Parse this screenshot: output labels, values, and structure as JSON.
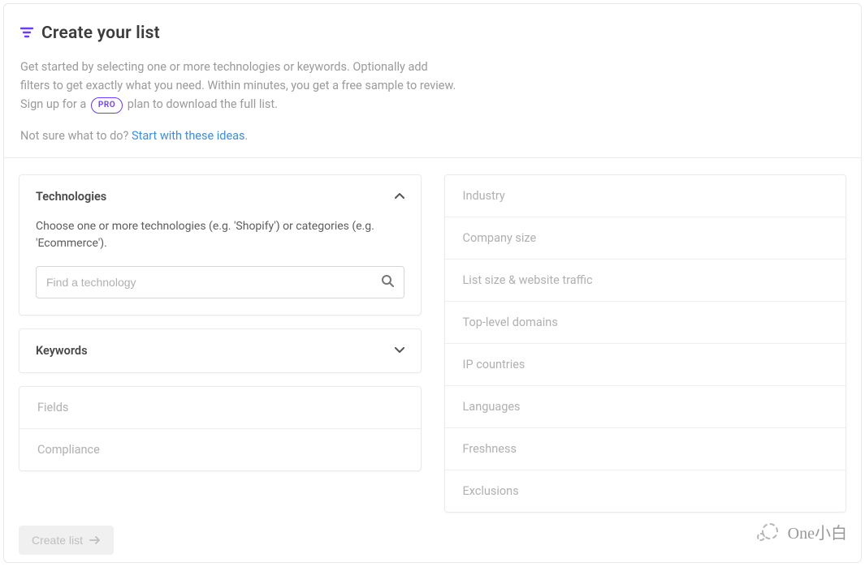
{
  "header": {
    "title": "Create your list",
    "subtitle_before_pro": "Get started by selecting one or more technologies or keywords. Optionally add filters to get exactly what you need. Within minutes, you get a free sample to review. Sign up for a ",
    "pro_label": "PRO",
    "subtitle_after_pro": " plan to download the full list.",
    "hint_prefix": "Not sure what to do? ",
    "hint_link": "Start with these ideas",
    "hint_suffix": "."
  },
  "left": {
    "technologies": {
      "title": "Technologies",
      "desc": "Choose one or more technologies (e.g. 'Shopify') or categories (e.g. 'Ecommerce').",
      "placeholder": "Find a technology"
    },
    "keywords": {
      "title": "Keywords"
    },
    "fields": {
      "title": "Fields"
    },
    "compliance": {
      "title": "Compliance"
    }
  },
  "right": {
    "items": [
      "Industry",
      "Company size",
      "List size & website traffic",
      "Top-level domains",
      "IP countries",
      "Languages",
      "Freshness",
      "Exclusions"
    ]
  },
  "footer": {
    "create_label": "Create list"
  },
  "watermark": "One小白"
}
